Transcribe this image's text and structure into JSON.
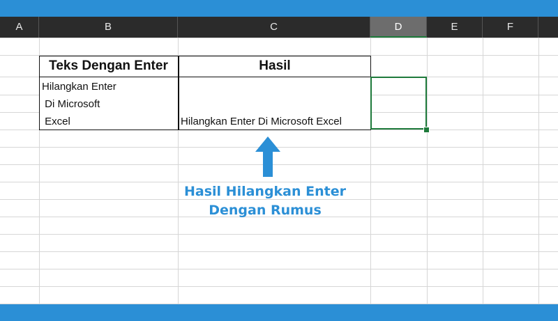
{
  "columns": [
    "A",
    "B",
    "C",
    "D",
    "E",
    "F"
  ],
  "table": {
    "header_b": "Teks Dengan Enter",
    "header_c": "Hasil",
    "b_lines": [
      "Hilangkan Enter",
      " Di Microsoft",
      " Excel"
    ],
    "c_result": "Hilangkan Enter Di Microsoft Excel"
  },
  "annotation": {
    "line1": "Hasil Hilangkan Enter",
    "line2": "Dengan Rumus"
  },
  "colors": {
    "accent": "#2b8fd6",
    "selection": "#1e7a3b",
    "header_bg": "#2b2b2b"
  }
}
